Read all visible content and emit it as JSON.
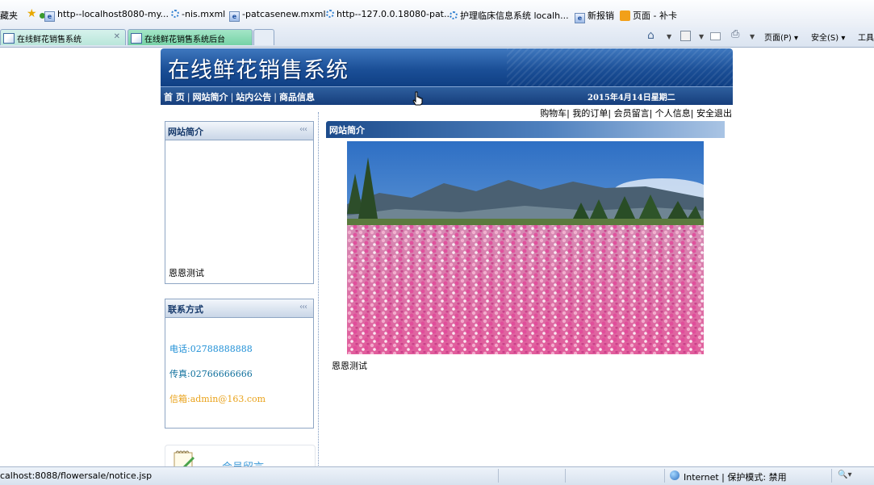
{
  "favorites_bar": {
    "label": "藏夹",
    "items": [
      {
        "icon": "ie-page-icon",
        "label": "http--localhost8080-my..."
      },
      {
        "icon": "loading-icon",
        "label": "-nis.mxml"
      },
      {
        "icon": "ie-page-icon",
        "label": "-patcasenew.mxml"
      },
      {
        "icon": "loading-icon",
        "label": "http--127.0.0.18080-pat..."
      },
      {
        "icon": "loading-icon",
        "label": "护理临床信息系统 localh..."
      },
      {
        "icon": "ie-page-icon",
        "label": "新报销"
      },
      {
        "icon": "orange-icon",
        "label": "页面 - 补卡"
      }
    ]
  },
  "tabs": [
    {
      "label": "在线鲜花销售系统",
      "close": "✕",
      "active": false
    },
    {
      "label": "在线鲜花销售系统后台",
      "active": true
    }
  ],
  "toolbar": {
    "page_menu": "页面(P)",
    "safety_menu": "安全(S)",
    "tools_menu": "工具"
  },
  "site": {
    "title": "在线鲜花销售系统",
    "nav": [
      "首 页",
      "网站简介",
      "站内公告",
      "商品信息"
    ],
    "nav_separator": "|",
    "date": "2015年4月14日星期二",
    "user_links": "购物车| 我的订单| 会员留言| 个人信息| 安全退出"
  },
  "sidebar": {
    "intro": {
      "title": "网站简介",
      "arrows": "‹‹‹",
      "text": "恩恩测试"
    },
    "contact": {
      "title": "联系方式",
      "arrows": "‹‹‹",
      "phone": "电话:02788888888",
      "fax": "传真:02766666666",
      "email": "信箱:admin@163.com",
      "colors": {
        "phone": "#1e8fd6",
        "fax": "#0e6f9c",
        "email": "#e9a21a"
      }
    },
    "message_label": "会员留言"
  },
  "main_panel": {
    "title": "网站简介",
    "caption": "恩恩测试"
  },
  "status_bar": {
    "url": "calhost:8088/flowersale/notice.jsp",
    "zone": "Internet | 保护模式: 禁用"
  },
  "colors": {
    "header_blue": "#1b4f97",
    "nav_blue": "#163e7c",
    "sidebox_border": "#8fa6c4"
  }
}
